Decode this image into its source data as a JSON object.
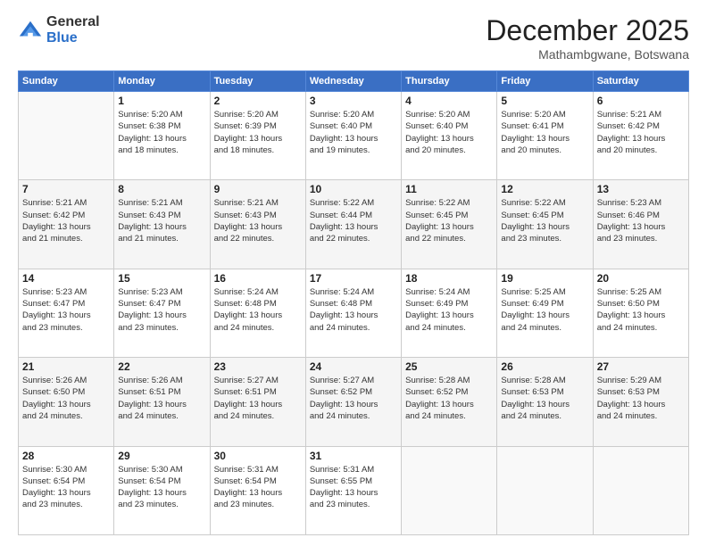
{
  "logo": {
    "general": "General",
    "blue": "Blue"
  },
  "title": "December 2025",
  "location": "Mathambgwane, Botswana",
  "days_of_week": [
    "Sunday",
    "Monday",
    "Tuesday",
    "Wednesday",
    "Thursday",
    "Friday",
    "Saturday"
  ],
  "weeks": [
    [
      {
        "day": "",
        "info": ""
      },
      {
        "day": "1",
        "info": "Sunrise: 5:20 AM\nSunset: 6:38 PM\nDaylight: 13 hours\nand 18 minutes."
      },
      {
        "day": "2",
        "info": "Sunrise: 5:20 AM\nSunset: 6:39 PM\nDaylight: 13 hours\nand 18 minutes."
      },
      {
        "day": "3",
        "info": "Sunrise: 5:20 AM\nSunset: 6:40 PM\nDaylight: 13 hours\nand 19 minutes."
      },
      {
        "day": "4",
        "info": "Sunrise: 5:20 AM\nSunset: 6:40 PM\nDaylight: 13 hours\nand 20 minutes."
      },
      {
        "day": "5",
        "info": "Sunrise: 5:20 AM\nSunset: 6:41 PM\nDaylight: 13 hours\nand 20 minutes."
      },
      {
        "day": "6",
        "info": "Sunrise: 5:21 AM\nSunset: 6:42 PM\nDaylight: 13 hours\nand 20 minutes."
      }
    ],
    [
      {
        "day": "7",
        "info": "Sunrise: 5:21 AM\nSunset: 6:42 PM\nDaylight: 13 hours\nand 21 minutes."
      },
      {
        "day": "8",
        "info": "Sunrise: 5:21 AM\nSunset: 6:43 PM\nDaylight: 13 hours\nand 21 minutes."
      },
      {
        "day": "9",
        "info": "Sunrise: 5:21 AM\nSunset: 6:43 PM\nDaylight: 13 hours\nand 22 minutes."
      },
      {
        "day": "10",
        "info": "Sunrise: 5:22 AM\nSunset: 6:44 PM\nDaylight: 13 hours\nand 22 minutes."
      },
      {
        "day": "11",
        "info": "Sunrise: 5:22 AM\nSunset: 6:45 PM\nDaylight: 13 hours\nand 22 minutes."
      },
      {
        "day": "12",
        "info": "Sunrise: 5:22 AM\nSunset: 6:45 PM\nDaylight: 13 hours\nand 23 minutes."
      },
      {
        "day": "13",
        "info": "Sunrise: 5:23 AM\nSunset: 6:46 PM\nDaylight: 13 hours\nand 23 minutes."
      }
    ],
    [
      {
        "day": "14",
        "info": "Sunrise: 5:23 AM\nSunset: 6:47 PM\nDaylight: 13 hours\nand 23 minutes."
      },
      {
        "day": "15",
        "info": "Sunrise: 5:23 AM\nSunset: 6:47 PM\nDaylight: 13 hours\nand 23 minutes."
      },
      {
        "day": "16",
        "info": "Sunrise: 5:24 AM\nSunset: 6:48 PM\nDaylight: 13 hours\nand 24 minutes."
      },
      {
        "day": "17",
        "info": "Sunrise: 5:24 AM\nSunset: 6:48 PM\nDaylight: 13 hours\nand 24 minutes."
      },
      {
        "day": "18",
        "info": "Sunrise: 5:24 AM\nSunset: 6:49 PM\nDaylight: 13 hours\nand 24 minutes."
      },
      {
        "day": "19",
        "info": "Sunrise: 5:25 AM\nSunset: 6:49 PM\nDaylight: 13 hours\nand 24 minutes."
      },
      {
        "day": "20",
        "info": "Sunrise: 5:25 AM\nSunset: 6:50 PM\nDaylight: 13 hours\nand 24 minutes."
      }
    ],
    [
      {
        "day": "21",
        "info": "Sunrise: 5:26 AM\nSunset: 6:50 PM\nDaylight: 13 hours\nand 24 minutes."
      },
      {
        "day": "22",
        "info": "Sunrise: 5:26 AM\nSunset: 6:51 PM\nDaylight: 13 hours\nand 24 minutes."
      },
      {
        "day": "23",
        "info": "Sunrise: 5:27 AM\nSunset: 6:51 PM\nDaylight: 13 hours\nand 24 minutes."
      },
      {
        "day": "24",
        "info": "Sunrise: 5:27 AM\nSunset: 6:52 PM\nDaylight: 13 hours\nand 24 minutes."
      },
      {
        "day": "25",
        "info": "Sunrise: 5:28 AM\nSunset: 6:52 PM\nDaylight: 13 hours\nand 24 minutes."
      },
      {
        "day": "26",
        "info": "Sunrise: 5:28 AM\nSunset: 6:53 PM\nDaylight: 13 hours\nand 24 minutes."
      },
      {
        "day": "27",
        "info": "Sunrise: 5:29 AM\nSunset: 6:53 PM\nDaylight: 13 hours\nand 24 minutes."
      }
    ],
    [
      {
        "day": "28",
        "info": "Sunrise: 5:30 AM\nSunset: 6:54 PM\nDaylight: 13 hours\nand 23 minutes."
      },
      {
        "day": "29",
        "info": "Sunrise: 5:30 AM\nSunset: 6:54 PM\nDaylight: 13 hours\nand 23 minutes."
      },
      {
        "day": "30",
        "info": "Sunrise: 5:31 AM\nSunset: 6:54 PM\nDaylight: 13 hours\nand 23 minutes."
      },
      {
        "day": "31",
        "info": "Sunrise: 5:31 AM\nSunset: 6:55 PM\nDaylight: 13 hours\nand 23 minutes."
      },
      {
        "day": "",
        "info": ""
      },
      {
        "day": "",
        "info": ""
      },
      {
        "day": "",
        "info": ""
      }
    ]
  ]
}
